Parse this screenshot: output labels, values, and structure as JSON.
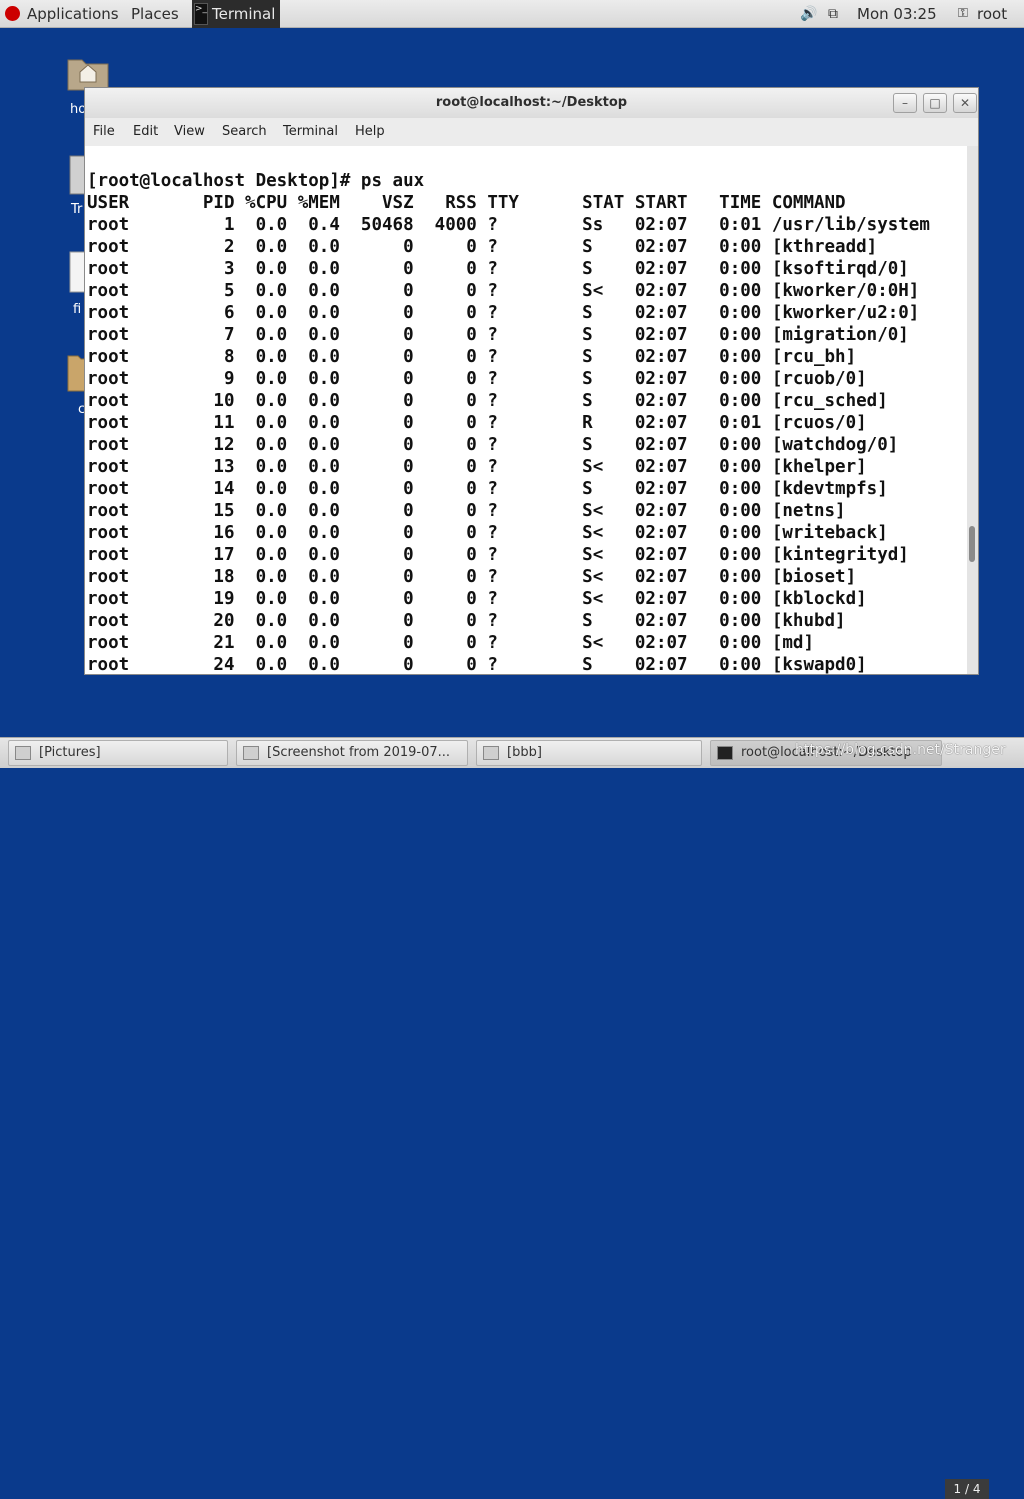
{
  "top_panel": {
    "applications": "Applications",
    "places": "Places",
    "terminal": "Terminal",
    "clock": "Mon 03:25",
    "user": "root"
  },
  "desktop": {
    "icons": [
      {
        "label": "ho"
      },
      {
        "label": "Tr"
      },
      {
        "label": "fi"
      },
      {
        "label": "c"
      }
    ]
  },
  "window": {
    "title": "root@localhost:~/Desktop",
    "menu": [
      "File",
      "Edit",
      "View",
      "Search",
      "Terminal",
      "Help"
    ],
    "lines": [
      "[root@localhost Desktop]# ps aux",
      "USER       PID %CPU %MEM    VSZ   RSS TTY      STAT START   TIME COMMAND",
      "root         1  0.0  0.4  50468  4000 ?        Ss   02:07   0:01 /usr/lib/system",
      "root         2  0.0  0.0      0     0 ?        S    02:07   0:00 [kthreadd]",
      "root         3  0.0  0.0      0     0 ?        S    02:07   0:00 [ksoftirqd/0]",
      "root         5  0.0  0.0      0     0 ?        S<   02:07   0:00 [kworker/0:0H]",
      "root         6  0.0  0.0      0     0 ?        S    02:07   0:00 [kworker/u2:0]",
      "root         7  0.0  0.0      0     0 ?        S    02:07   0:00 [migration/0]",
      "root         8  0.0  0.0      0     0 ?        S    02:07   0:00 [rcu_bh]",
      "root         9  0.0  0.0      0     0 ?        S    02:07   0:00 [rcuob/0]",
      "root        10  0.0  0.0      0     0 ?        S    02:07   0:00 [rcu_sched]",
      "root        11  0.0  0.0      0     0 ?        R    02:07   0:01 [rcuos/0]",
      "root        12  0.0  0.0      0     0 ?        S    02:07   0:00 [watchdog/0]",
      "root        13  0.0  0.0      0     0 ?        S<   02:07   0:00 [khelper]",
      "root        14  0.0  0.0      0     0 ?        S    02:07   0:00 [kdevtmpfs]",
      "root        15  0.0  0.0      0     0 ?        S<   02:07   0:00 [netns]",
      "root        16  0.0  0.0      0     0 ?        S<   02:07   0:00 [writeback]",
      "root        17  0.0  0.0      0     0 ?        S<   02:07   0:00 [kintegrityd]",
      "root        18  0.0  0.0      0     0 ?        S<   02:07   0:00 [bioset]",
      "root        19  0.0  0.0      0     0 ?        S<   02:07   0:00 [kblockd]",
      "root        20  0.0  0.0      0     0 ?        S    02:07   0:00 [khubd]",
      "root        21  0.0  0.0      0     0 ?        S<   02:07   0:00 [md]",
      "root        24  0.0  0.0      0     0 ?        S    02:07   0:00 [kswapd0]"
    ]
  },
  "taskbar": {
    "items": [
      {
        "label": "[Pictures]"
      },
      {
        "label": "[Screenshot from 2019-07..."
      },
      {
        "label": "[bbb]"
      },
      {
        "label": "root@localhost:~/Desktop"
      }
    ],
    "watermark": "https://blog.csdn.net/Stranger",
    "pager": "1 / 4"
  }
}
